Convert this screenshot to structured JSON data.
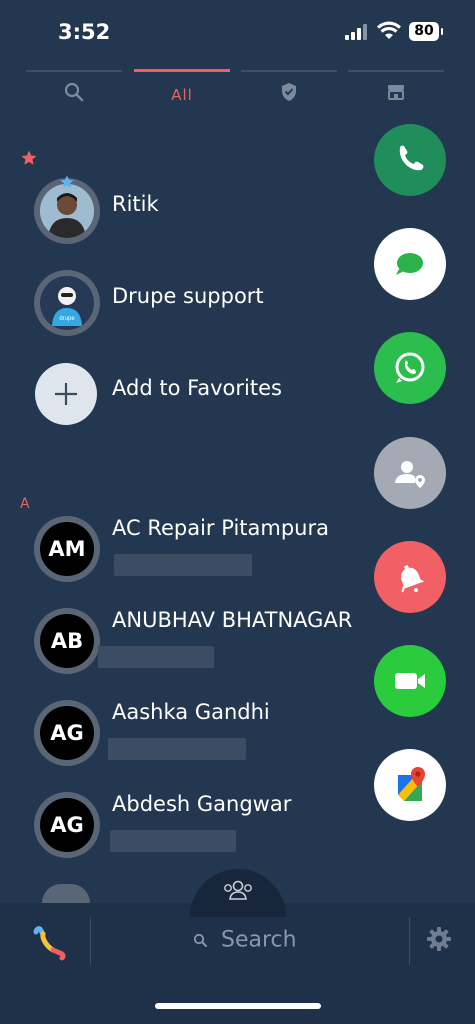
{
  "status_bar": {
    "time": "3:52",
    "battery": "80"
  },
  "tabs": [
    {
      "name": "search",
      "icon": "search-icon"
    },
    {
      "name": "all",
      "label": "All",
      "active": true
    },
    {
      "name": "blocked",
      "icon": "shield-icon"
    },
    {
      "name": "store",
      "icon": "store-icon"
    }
  ],
  "favorites": [
    {
      "name": "Ritik"
    },
    {
      "name": "Drupe support"
    },
    {
      "name": "Add to Favorites"
    }
  ],
  "section_letter": "A",
  "contacts": [
    {
      "initials": "AM",
      "name": "AC Repair Pitampura"
    },
    {
      "initials": "AB",
      "name": "ANUBHAV BHATNAGAR"
    },
    {
      "initials": "AG",
      "name": "Aashka Gandhi"
    },
    {
      "initials": "AG",
      "name": "Abdesh Gangwar"
    }
  ],
  "actions": [
    {
      "name": "phone-call",
      "color": "#1f8e5a"
    },
    {
      "name": "sms",
      "color": "#ffffff"
    },
    {
      "name": "whatsapp",
      "color": "#2bbd4e"
    },
    {
      "name": "contact-location",
      "color": "#a4aab3"
    },
    {
      "name": "reminder",
      "color": "#f06064"
    },
    {
      "name": "facetime",
      "color": "#2bcb3e"
    },
    {
      "name": "google-maps",
      "color": "#ffffff"
    }
  ],
  "bottom_bar": {
    "search_placeholder": "Search"
  }
}
